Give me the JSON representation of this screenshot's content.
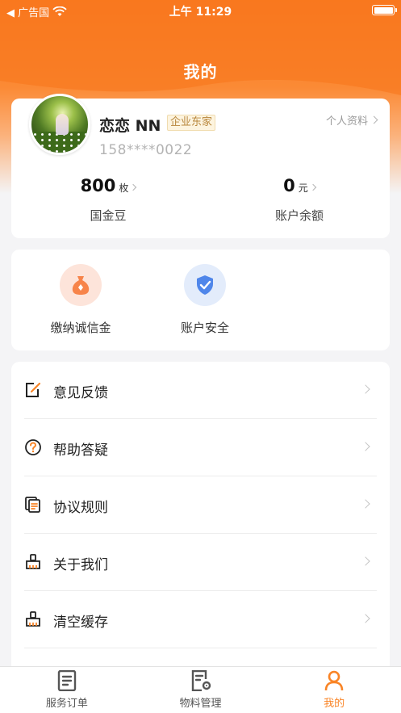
{
  "status_bar": {
    "carrier": "◀ 广告国",
    "time": "上午 11:29"
  },
  "header": {
    "title": "我的"
  },
  "profile": {
    "name": "恋恋 NN",
    "badge": "企业东家",
    "phone": "158****0022",
    "link_label": "个人资料",
    "stats": [
      {
        "value": "800",
        "unit": "枚",
        "label": "国金豆"
      },
      {
        "value": "0",
        "unit": "元",
        "label": "账户余额"
      }
    ]
  },
  "actions": [
    {
      "label": "缴纳诚信金",
      "icon": "money-bag-icon"
    },
    {
      "label": "账户安全",
      "icon": "shield-check-icon"
    }
  ],
  "menu": [
    {
      "label": "意见反馈",
      "icon": "edit-square-icon"
    },
    {
      "label": "帮助答疑",
      "icon": "question-circle-icon"
    },
    {
      "label": "协议规则",
      "icon": "documents-icon"
    },
    {
      "label": "关于我们",
      "icon": "broom-icon"
    },
    {
      "label": "清空缓存",
      "icon": "broom-icon"
    }
  ],
  "tab_bar": {
    "tabs": [
      {
        "label": "服务订单",
        "icon": "order-list-icon",
        "active": false
      },
      {
        "label": "物料管理",
        "icon": "material-settings-icon",
        "active": false
      },
      {
        "label": "我的",
        "icon": "person-icon",
        "active": true
      }
    ]
  },
  "colors": {
    "accent": "#f98426",
    "header_orange": "#fa7a22",
    "badge_text": "#b8863b"
  }
}
